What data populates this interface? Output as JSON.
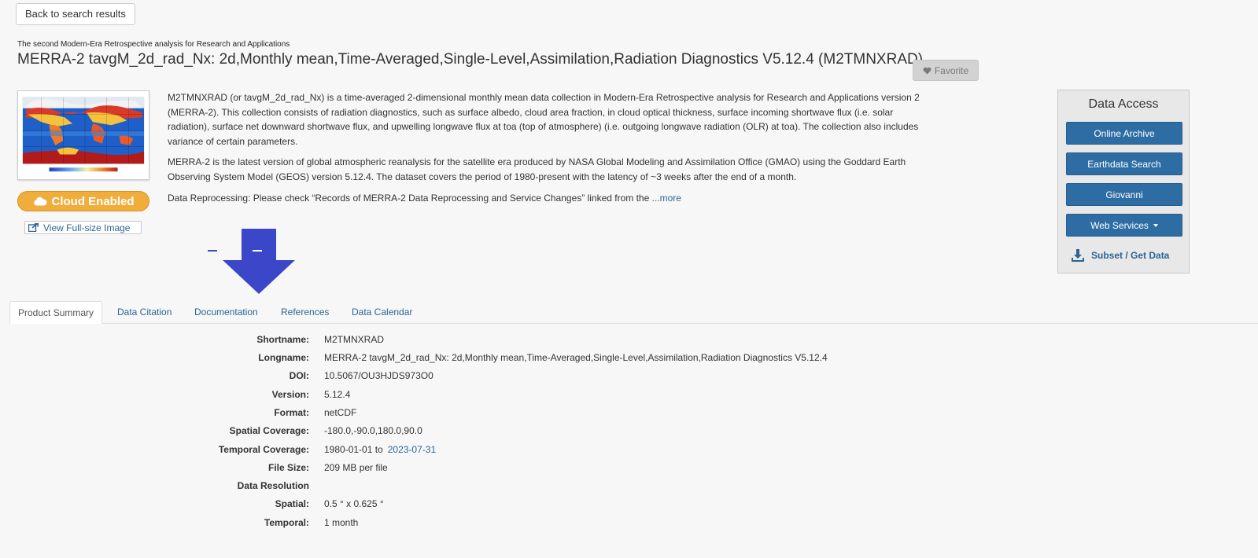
{
  "nav": {
    "back_label": "Back to search results"
  },
  "header": {
    "subtitle": "The second Modern-Era Retrospective analysis for Research and Applications",
    "title": "MERRA-2 tavgM_2d_rad_Nx: 2d,Monthly mean,Time-Averaged,Single-Level,Assimilation,Radiation Diagnostics V5.12.4 (M2TMNXRAD)",
    "favorite_label": "Favorite"
  },
  "sidebar_left": {
    "cloud_badge": "Cloud Enabled",
    "fullsize_link": "View Full-size Image"
  },
  "description": {
    "p1": "M2TMNXRAD (or tavgM_2d_rad_Nx) is a time-averaged 2-dimensional monthly mean data collection in Modern-Era Retrospective analysis for Research and Applications version 2 (MERRA-2). This collection consists of radiation diagnostics, such as surface albedo, cloud area fraction, in cloud optical thickness, surface incoming shortwave flux (i.e. solar radiation), surface net downward shortwave flux, and upwelling longwave flux at toa (top of atmosphere) (i.e. outgoing longwave radiation (OLR) at toa). The collection also includes variance of certain parameters.",
    "p2": "MERRA-2 is the latest version of global atmospheric reanalysis for the satellite era produced by NASA Global Modeling and Assimilation Office (GMAO) using the Goddard Earth Observing System Model (GEOS) version 5.12.4. The dataset covers the period of 1980-present with the latency of ~3 weeks after the end of a month.",
    "p3": "Data Reprocessing: Please check “Records of MERRA-2 Data Reprocessing and Service Changes” linked from the",
    "more_link": "...more"
  },
  "data_access": {
    "title": "Data Access",
    "buttons": [
      "Online Archive",
      "Earthdata Search",
      "Giovanni",
      "Web Services"
    ],
    "subset_label": "Subset / Get Data"
  },
  "tabs": [
    "Product Summary",
    "Data Citation",
    "Documentation",
    "References",
    "Data Calendar"
  ],
  "summary": {
    "shortname_k": "Shortname:",
    "shortname_v": "M2TMNXRAD",
    "longname_k": "Longname:",
    "longname_v": "MERRA-2 tavgM_2d_rad_Nx: 2d,Monthly mean,Time-Averaged,Single-Level,Assimilation,Radiation Diagnostics V5.12.4",
    "doi_k": "DOI:",
    "doi_v": "10.5067/OU3HJDS973O0",
    "version_k": "Version:",
    "version_v": "5.12.4",
    "format_k": "Format:",
    "format_v": "netCDF",
    "spatial_cov_k": "Spatial Coverage:",
    "spatial_cov_v": "-180.0,-90.0,180.0,90.0",
    "temporal_cov_k": "Temporal Coverage:",
    "temporal_cov_v": "1980-01-01 to",
    "temporal_cov_link": "2023-07-31",
    "filesize_k": "File Size:",
    "filesize_v": "209 MB per file",
    "resolution_k": "Data Resolution",
    "spatial_k": "Spatial:",
    "spatial_v": "0.5 ° x 0.625 °",
    "temporal_k": "Temporal:",
    "temporal_v": "1 month"
  },
  "colors": {
    "link": "#2a6496",
    "button": "#2e6da4",
    "badge": "#f0ad3c",
    "arrow": "#3b46c9"
  }
}
